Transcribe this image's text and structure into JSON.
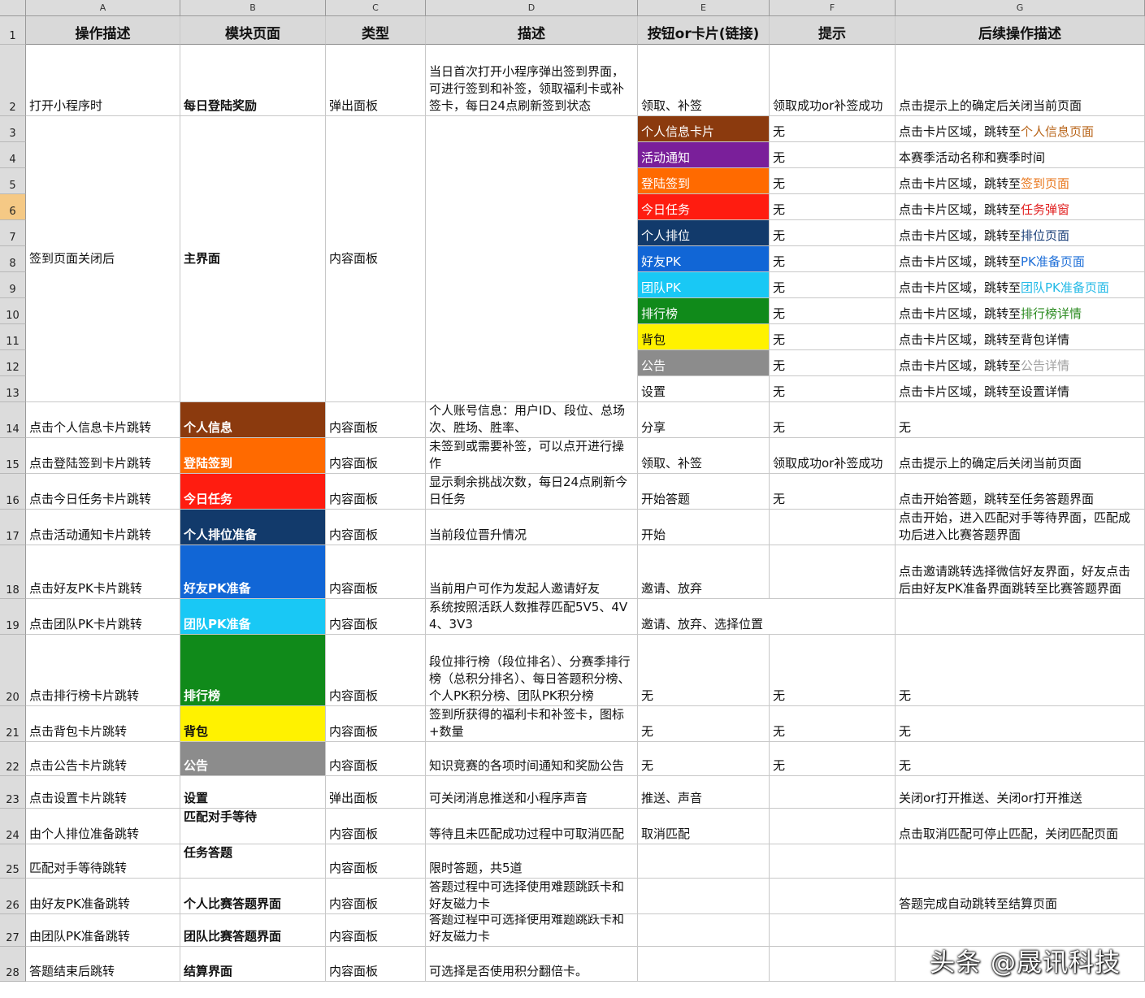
{
  "columns": [
    "A",
    "B",
    "C",
    "D",
    "E",
    "F",
    "G"
  ],
  "rows": [
    "1",
    "2",
    "3",
    "4",
    "5",
    "6",
    "7",
    "8",
    "9",
    "10",
    "11",
    "12",
    "13",
    "14",
    "15",
    "16",
    "17",
    "18",
    "19",
    "20",
    "21",
    "22",
    "23",
    "24",
    "25",
    "26",
    "27",
    "28"
  ],
  "selected_row": "6",
  "header": {
    "A": "操作描述",
    "B": "模块页面",
    "C": "类型",
    "D": "描述",
    "E": "按钮or卡片(链接)",
    "F": "提示",
    "G": "后续操作描述"
  },
  "colors": {
    "brown": "#8b3a0e",
    "purple": "#7a1f9a",
    "orange": "#ff6a00",
    "red": "#ff1c10",
    "navy": "#123a6b",
    "blue": "#1166d6",
    "sky": "#19c8f5",
    "green": "#108a1a",
    "yellow": "#fff200",
    "gray": "#8c8c8c",
    "header_bg": "#d9d9d9",
    "link_brown": "#b8651a",
    "link_orange": "#e8761b",
    "link_red": "#e12121",
    "link_navy": "#1a3f78",
    "link_blue": "#1e6fd8",
    "link_sky": "#22b9e6",
    "link_green": "#2a8a1f",
    "link_gray": "#a0a0a0"
  },
  "r2": {
    "a": "打开小程序时",
    "b": "每日登陆奖励",
    "c": "弹出面板",
    "d": "当日首次打开小程序弹出签到界面，可进行签到和补签，领取福利卡或补签卡，每日24点刷新签到状态",
    "e": "领取、补签",
    "f": "领取成功or补签成功",
    "g": "点击提示上的确定后关闭当前页面"
  },
  "main": {
    "a": "签到页面关闭后",
    "b": "主界面",
    "c": "内容面板"
  },
  "cards": {
    "e3": "个人信息卡片",
    "f3": "无",
    "g3_pre": "点击卡片区域，跳转至",
    "g3_link": "个人信息页面",
    "e4": "活动通知",
    "f4": "无",
    "g4": "本赛季活动名称和赛季时间",
    "e5": "登陆签到",
    "f5": "无",
    "g5_pre": "点击卡片区域，跳转至",
    "g5_link": "签到页面",
    "e6": "今日任务",
    "f6": "无",
    "g6_pre": "点击卡片区域，跳转至",
    "g6_link": "任务弹窗",
    "e7": "个人排位",
    "f7": "无",
    "g7_pre": "点击卡片区域，跳转至",
    "g7_link": "排位页面",
    "e8": "好友PK",
    "f8": "无",
    "g8_pre": "点击卡片区域，跳转至",
    "g8_link": "PK准备页面",
    "e9": "团队PK",
    "f9": "无",
    "g9_pre": "点击卡片区域，跳转至",
    "g9_link": "团队PK准备页面",
    "e10": "排行榜",
    "f10": "无",
    "g10_pre": "点击卡片区域，跳转至",
    "g10_link": "排行榜详情",
    "e11": "背包",
    "f11": "无",
    "g11": "点击卡片区域，跳转至背包详情",
    "e12": "公告",
    "f12": "无",
    "g12_pre": "点击卡片区域，跳转至",
    "g12_link": "公告详情",
    "e13": "设置",
    "f13": "无",
    "g13": "点击卡片区域，跳转至设置详情"
  },
  "r14": {
    "a": "点击个人信息卡片跳转",
    "b": "个人信息",
    "c": "内容面板",
    "d": "个人账号信息：用户ID、段位、总场次、胜场、胜率、",
    "e": "分享",
    "f": "无",
    "g": "无"
  },
  "r15": {
    "a": "点击登陆签到卡片跳转",
    "b": "登陆签到",
    "c": "内容面板",
    "d": "未签到或需要补签，可以点开进行操作",
    "e": "领取、补签",
    "f": "领取成功or补签成功",
    "g": "点击提示上的确定后关闭当前页面"
  },
  "r16": {
    "a": "点击今日任务卡片跳转",
    "b": "今日任务",
    "c": "内容面板",
    "d": "显示剩余挑战次数，每日24点刷新今日任务",
    "e": "开始答题",
    "f": "无",
    "g": "点击开始答题，跳转至任务答题界面"
  },
  "r17": {
    "a": "点击活动通知卡片跳转",
    "b": "个人排位准备",
    "c": "内容面板",
    "d": "当前段位晋升情况",
    "e": "开始",
    "f": "",
    "g": "点击开始，进入匹配对手等待界面，匹配成功后进入比赛答题界面"
  },
  "r18": {
    "a": "点击好友PK卡片跳转",
    "b": "好友PK准备",
    "c": "内容面板",
    "d": "当前用户可作为发起人邀请好友",
    "e": "邀请、放弃",
    "f": "",
    "g": "点击邀请跳转选择微信好友界面，好友点击后由好友PK准备界面跳转至比赛答题界面"
  },
  "r19": {
    "a": "点击团队PK卡片跳转",
    "b": "团队PK准备",
    "c": "内容面板",
    "d": "系统按照活跃人数推荐匹配5V5、4V4、3V3",
    "e": "邀请、放弃、选择位置",
    "f": "",
    "g": ""
  },
  "r20": {
    "a": "点击排行榜卡片跳转",
    "b": "排行榜",
    "c": "内容面板",
    "d": "段位排行榜（段位排名）、分赛季排行榜（总积分排名）、每日答题积分榜、个人PK积分榜、团队PK积分榜",
    "e": "无",
    "f": "无",
    "g": "无"
  },
  "r21": {
    "a": "点击背包卡片跳转",
    "b": "背包",
    "c": "内容面板",
    "d": "签到所获得的福利卡和补签卡，图标+数量",
    "e": "无",
    "f": "无",
    "g": "无"
  },
  "r22": {
    "a": "点击公告卡片跳转",
    "b": "公告",
    "c": "内容面板",
    "d": "知识竞赛的各项时间通知和奖励公告",
    "e": "无",
    "f": "无",
    "g": "无"
  },
  "r23": {
    "a": "点击设置卡片跳转",
    "b": "设置",
    "c": "弹出面板",
    "d": "可关闭消息推送和小程序声音",
    "e": "推送、声音",
    "f": "",
    "g": "关闭or打开推送、关闭or打开推送"
  },
  "r24": {
    "a": "由个人排位准备跳转",
    "b": "匹配对手等待",
    "c": "内容面板",
    "d": "等待且未匹配成功过程中可取消匹配",
    "e": "取消匹配",
    "f": "",
    "g": "点击取消匹配可停止匹配，关闭匹配页面"
  },
  "r25": {
    "a": "匹配对手等待跳转",
    "b": "任务答题",
    "c": "内容面板",
    "d": "限时答题，共5道",
    "e": "",
    "f": "",
    "g": ""
  },
  "r26": {
    "a": "由好友PK准备跳转",
    "b": "个人比赛答题界面",
    "c": "内容面板",
    "d": "答题过程中可选择使用难题跳跃卡和好友磁力卡",
    "e": "",
    "f": "",
    "g": "答题完成自动跳转至结算页面"
  },
  "r27": {
    "a": "由团队PK准备跳转",
    "b": "团队比赛答题界面",
    "c": "内容面板",
    "d": "答题过程中可选择使用难题跳跃卡和好友磁力卡",
    "e": "",
    "f": "",
    "g": ""
  },
  "r28": {
    "a": "答题结束后跳转",
    "b": "结算界面",
    "c": "内容面板",
    "d": "可选择是否使用积分翻倍卡。",
    "e": "",
    "f": "",
    "g": ""
  },
  "watermark": "头条 @晟讯科技"
}
